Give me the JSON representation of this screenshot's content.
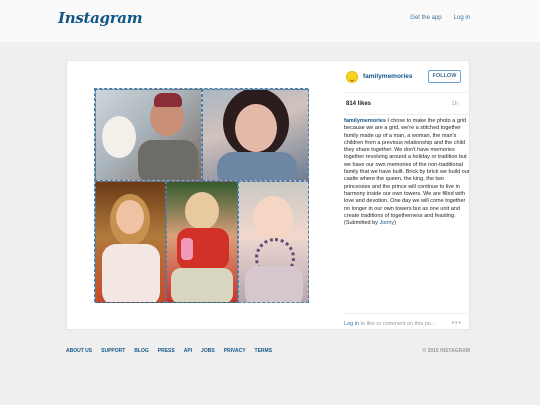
{
  "header": {
    "logo": "Instagram",
    "get_app": "Get the app",
    "login": "Log in"
  },
  "post": {
    "username": "familymemories",
    "follow_label": "FOLLOW",
    "likes": "814 likes",
    "age": "1h",
    "caption_user": "familymemories",
    "caption_text": " I chose to make the photo a grid because we are a grid, we're a stitched together family made up of a man, a woman, the man's children from a previous relationship and the child they share together. We don't have memories together revolving around a holiday or tradition but we have our own memories of the non-traditional family that we have built. Brick by brick we build our castle where the queen, the king, the two princesses and the prince will continue to live in harmony inside our own towers. We are filled with love and devotion. One day we will come together no longer in our own towers but as one unit and create traditions of togetherness and feasting. (Submitted by ",
    "caption_mention": "Jonny",
    "caption_end": ")",
    "login_link": "Log in",
    "login_rest": " to like or comment on this po...",
    "more": "•••"
  },
  "footer": {
    "links": [
      "ABOUT US",
      "SUPPORT",
      "BLOG",
      "PRESS",
      "API",
      "JOBS",
      "PRIVACY",
      "TERMS"
    ],
    "copyright": "© 2015 INSTAGRAM"
  },
  "colors": {
    "brand": "#125688",
    "link": "#3f729b",
    "background": "#efefef"
  }
}
